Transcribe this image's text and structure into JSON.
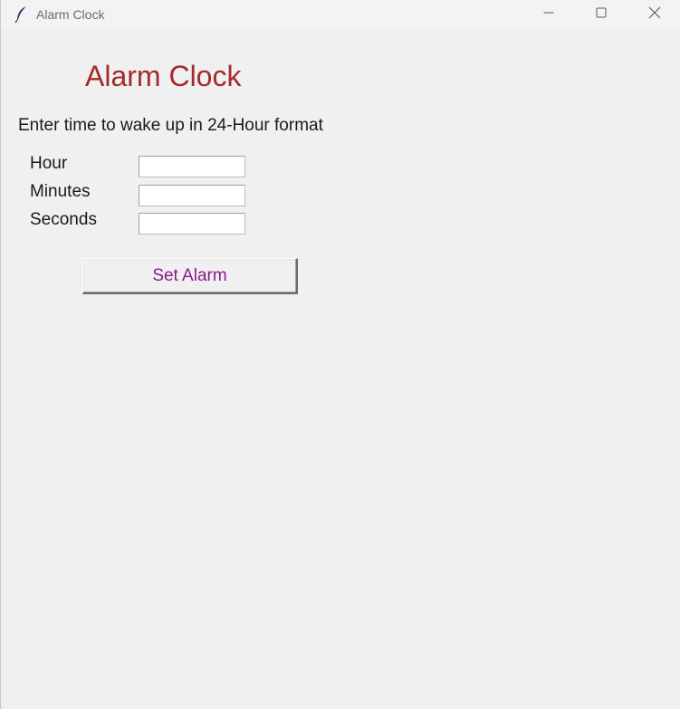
{
  "window": {
    "title": "Alarm Clock",
    "controls": {
      "minimize": "minimize-icon",
      "maximize": "maximize-icon",
      "close": "close-icon"
    },
    "app_icon": "feather-icon"
  },
  "main": {
    "heading": "Alarm Clock",
    "instruction": "Enter time to wake up in 24-Hour format",
    "fields": [
      {
        "label": "Hour",
        "value": ""
      },
      {
        "label": "Minutes",
        "value": ""
      },
      {
        "label": "Seconds",
        "value": ""
      }
    ],
    "set_alarm_label": "Set Alarm"
  },
  "colors": {
    "background": "#f0f0f0",
    "heading": "#a52a2a",
    "button_text": "#8b1a8b"
  }
}
